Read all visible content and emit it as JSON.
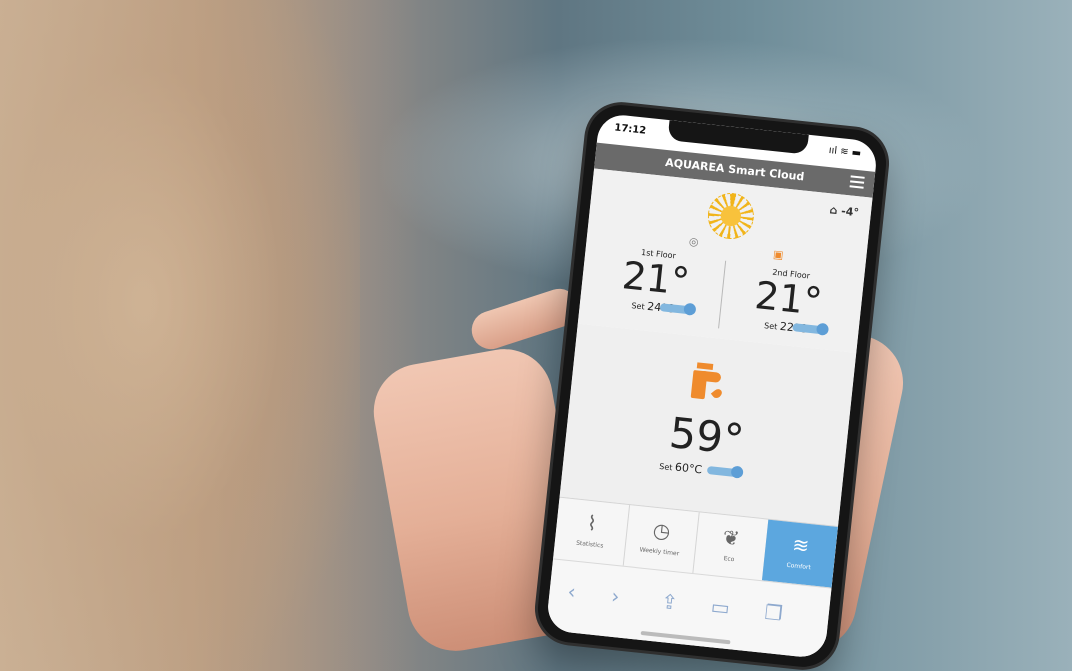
{
  "status": {
    "time": "17:12",
    "icons_text": "ııl ≋ ▬"
  },
  "app": {
    "title": "AQUAREA Smart Cloud",
    "outdoor_temp": "-4°"
  },
  "zones": [
    {
      "label": "1st Floor",
      "temperature": "21°",
      "set_label": "Set",
      "set_value": "24°C"
    },
    {
      "label": "2nd Floor",
      "temperature": "21°",
      "set_label": "Set",
      "set_value": "22°C"
    }
  ],
  "water": {
    "temperature": "59°",
    "set_label": "Set",
    "set_value": "60°C"
  },
  "nav": [
    {
      "label": "Statistics"
    },
    {
      "label": "Weekly timer"
    },
    {
      "label": "Eco"
    },
    {
      "label": "Comfort",
      "active": true
    }
  ],
  "colors": {
    "header": "#6a6a6a",
    "accent_blue": "#5ca7df",
    "accent_orange": "#ef8b2d"
  }
}
